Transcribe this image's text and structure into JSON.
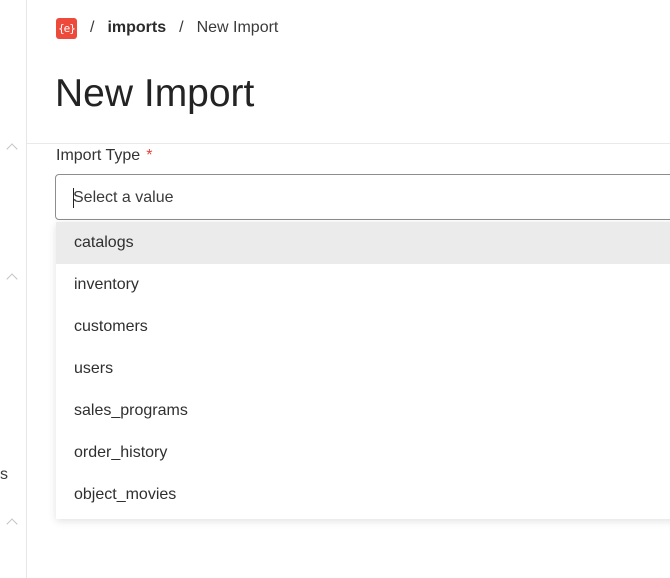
{
  "breadcrumb": {
    "logo_text": "{e}",
    "separator": "/",
    "parent": "imports",
    "current": "New Import"
  },
  "page": {
    "title": "New Import"
  },
  "form": {
    "import_type": {
      "label": "Import Type",
      "required_marker": "*",
      "placeholder": "Select a value",
      "value": "",
      "options": [
        "catalogs",
        "inventory",
        "customers",
        "users",
        "sales_programs",
        "order_history",
        "object_movies"
      ],
      "highlighted_option": "catalogs"
    }
  },
  "sidebar": {
    "partial_label": "s"
  },
  "colors": {
    "brand": "#ee4a3c",
    "required": "#e2423a",
    "highlight": "#ebebeb"
  }
}
